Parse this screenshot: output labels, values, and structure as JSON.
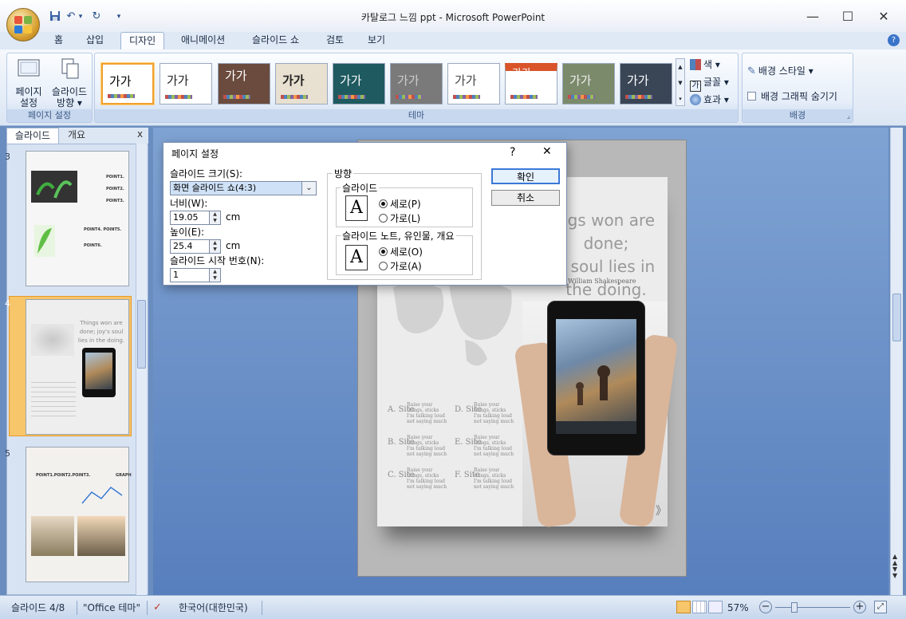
{
  "window": {
    "title": "카탈로그 느낌 ppt - Microsoft PowerPoint",
    "controls": {
      "minimize": "—",
      "maximize": "☐",
      "close": "✕"
    }
  },
  "quick_access": {
    "save_icon": "💾",
    "undo_icon": "↶",
    "redo_icon": "↻",
    "dropdown": "▾",
    "sep": "▾"
  },
  "tabs": [
    "홈",
    "삽입",
    "디자인",
    "애니메이션",
    "슬라이드 쇼",
    "검토",
    "보기"
  ],
  "active_tab": "디자인",
  "help": "?",
  "ribbon": {
    "page_setup": {
      "btn1": "페이지\n설정",
      "btn1_l1": "페이지",
      "btn1_l2": "설정",
      "btn2_l1": "슬라이드",
      "btn2_l2": "방향 ▾",
      "label": "페이지 설정"
    },
    "themes": {
      "label": "테마",
      "tile_text": "가가",
      "side_buttons": {
        "colors": "색 ▾",
        "fonts": "글꼴 ▾",
        "effects": "효과 ▾",
        "fonts_icon": "가"
      }
    },
    "background": {
      "style": "배경 스타일 ▾",
      "hide": "배경 그래픽 숨기기",
      "label": "배경",
      "launcher": "⌟"
    }
  },
  "pane": {
    "tab_slides": "슬라이드",
    "tab_outline": "개요",
    "close": "x",
    "thumbs": [
      {
        "num": "3"
      },
      {
        "num": "4"
      },
      {
        "num": "5"
      }
    ],
    "thumb3_labels": [
      "POINT1.",
      "POINT2.",
      "POINT3.",
      "POINT4.",
      "POINT5.",
      "POINT6."
    ],
    "thumb4_quote": "Things won are done; joy's soul lies in the doing.",
    "thumb5_heading": "POINT1.POINT2.POINT3.",
    "thumb5_graph": "GRAPH"
  },
  "slide": {
    "quote_lines": [
      "ngs won are",
      "done;",
      "s soul lies in",
      "the doing."
    ],
    "author": "William Shakespeare",
    "sites": [
      {
        "label": "A. Site",
        "text": [
          "Raise your",
          "things, sticks",
          "I'm talking loud",
          "not saying much"
        ]
      },
      {
        "label": "D. Site",
        "text": [
          "Raise your",
          "things, sticks",
          "I'm talking loud",
          "not saying much"
        ]
      },
      {
        "label": "B. Site",
        "text": [
          "Raise your",
          "things, sticks",
          "I'm talking loud",
          "not saying much"
        ]
      },
      {
        "label": "E. Site",
        "text": [
          "Raise your",
          "things, sticks",
          "I'm talking loud",
          "not saying much"
        ]
      },
      {
        "label": "C. Site",
        "text": [
          "Raise your",
          "things, sticks",
          "I'm talking loud",
          "not saying much"
        ]
      },
      {
        "label": "F. Site",
        "text": [
          "Raise your",
          "things, sticks",
          "I'm talking loud",
          "not saying much"
        ]
      }
    ],
    "page_arrow": "》"
  },
  "dialog": {
    "title": "페이지 설정",
    "help": "?",
    "close": "✕",
    "size_label": "슬라이드 크기(S):",
    "size_value": "화면 슬라이드 쇼(4:3)",
    "width_label": "너비(W):",
    "width_value": "19.05",
    "height_label": "높이(E):",
    "height_value": "25.4",
    "unit": "cm",
    "start_label": "슬라이드 시작 번호(N):",
    "start_value": "1",
    "orientation": "방향",
    "slides_group": "슬라이드",
    "notes_group": "슬라이드 노트, 유인물, 개요",
    "portrait_p": "세로(P)",
    "landscape_l": "가로(L)",
    "portrait_o": "세로(O)",
    "landscape_a": "가로(A)",
    "icon_letter": "A",
    "ok": "확인",
    "cancel": "취소"
  },
  "status": {
    "slide": "슬라이드 4/8",
    "theme": "\"Office 테마\"",
    "lang": "한국어(대한민국)",
    "zoom": "57%",
    "minus": "−",
    "plus": "+"
  }
}
